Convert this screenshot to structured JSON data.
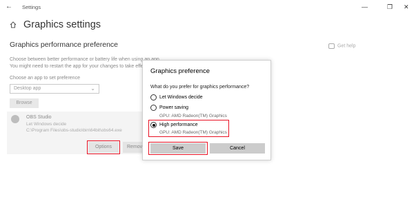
{
  "window": {
    "title": "Settings",
    "back_glyph": "←",
    "minimize_glyph": "—",
    "restore_glyph": "❐",
    "close_glyph": "✕"
  },
  "page": {
    "title": "Graphics settings",
    "section_title": "Graphics performance preference",
    "description_line1": "Choose between better performance or battery life when using an app.",
    "description_line2": "You might need to restart the app for your changes to take effect.",
    "choose_label": "Choose an app to set preference",
    "dropdown_value": "Desktop app",
    "browse_label": "Browse",
    "help_label": "Get help"
  },
  "app": {
    "name": "OBS Studio",
    "preference": "Let Windows decide",
    "path": "C:\\Program Files\\obs-studio\\bin\\64bit\\obs64.exe",
    "options_label": "Options",
    "remove_label": "Remove"
  },
  "dialog": {
    "title": "Graphics preference",
    "question": "What do you prefer for graphics performance?",
    "options": [
      {
        "label": "Let Windows decide",
        "gpu": "",
        "selected": false
      },
      {
        "label": "Power saving",
        "gpu": "GPU: AMD Radeon(TM) Graphics",
        "selected": false
      },
      {
        "label": "High performance",
        "gpu": "GPU: AMD Radeon(TM) Graphics",
        "selected": true
      }
    ],
    "save_label": "Save",
    "cancel_label": "Cancel"
  },
  "colors": {
    "highlight": "#e81123",
    "button_gray": "#cccccc"
  }
}
